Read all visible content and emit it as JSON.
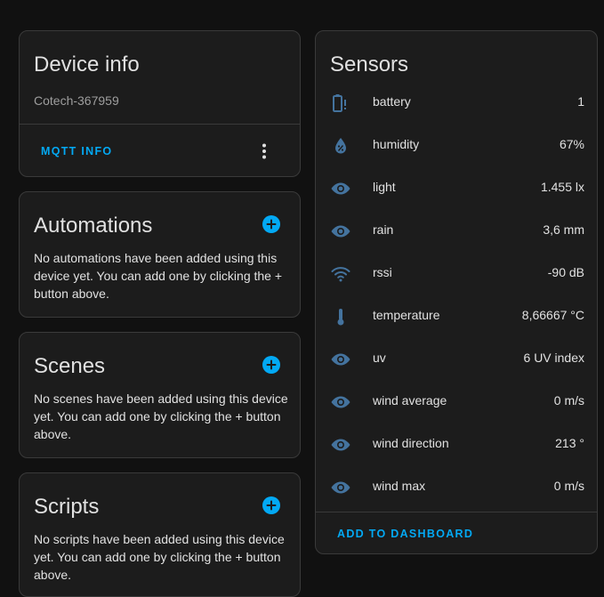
{
  "device_info": {
    "title": "Device info",
    "device_name": "Cotech-367959",
    "mqtt_info_label": "MQTT INFO"
  },
  "automations": {
    "title": "Automations",
    "empty_text": "No automations have been added using this device yet. You can add one by clicking the + button above."
  },
  "scenes": {
    "title": "Scenes",
    "empty_text": "No scenes have been added using this device yet. You can add one by clicking the + button above."
  },
  "scripts": {
    "title": "Scripts",
    "empty_text": "No scripts have been added using this device yet. You can add one by clicking the + button above."
  },
  "sensors": {
    "title": "Sensors",
    "items": [
      {
        "name": "battery",
        "value": "1",
        "icon": "battery-alert-icon"
      },
      {
        "name": "humidity",
        "value": "67%",
        "icon": "water-percent-icon"
      },
      {
        "name": "light",
        "value": "1.455 lx",
        "icon": "eye-icon"
      },
      {
        "name": "rain",
        "value": "3,6 mm",
        "icon": "eye-icon"
      },
      {
        "name": "rssi",
        "value": "-90 dB",
        "icon": "wifi-icon"
      },
      {
        "name": "temperature",
        "value": "8,66667 °C",
        "icon": "thermometer-icon"
      },
      {
        "name": "uv",
        "value": "6 UV index",
        "icon": "eye-icon"
      },
      {
        "name": "wind average",
        "value": "0 m/s",
        "icon": "eye-icon"
      },
      {
        "name": "wind direction",
        "value": "213 °",
        "icon": "eye-icon"
      },
      {
        "name": "wind max",
        "value": "0 m/s",
        "icon": "eye-icon"
      }
    ],
    "add_to_dashboard_label": "ADD TO DASHBOARD"
  },
  "colors": {
    "accent": "#03a9f4",
    "icon": "#44739e",
    "card_bg": "#1c1c1c",
    "page_bg": "#111111"
  }
}
